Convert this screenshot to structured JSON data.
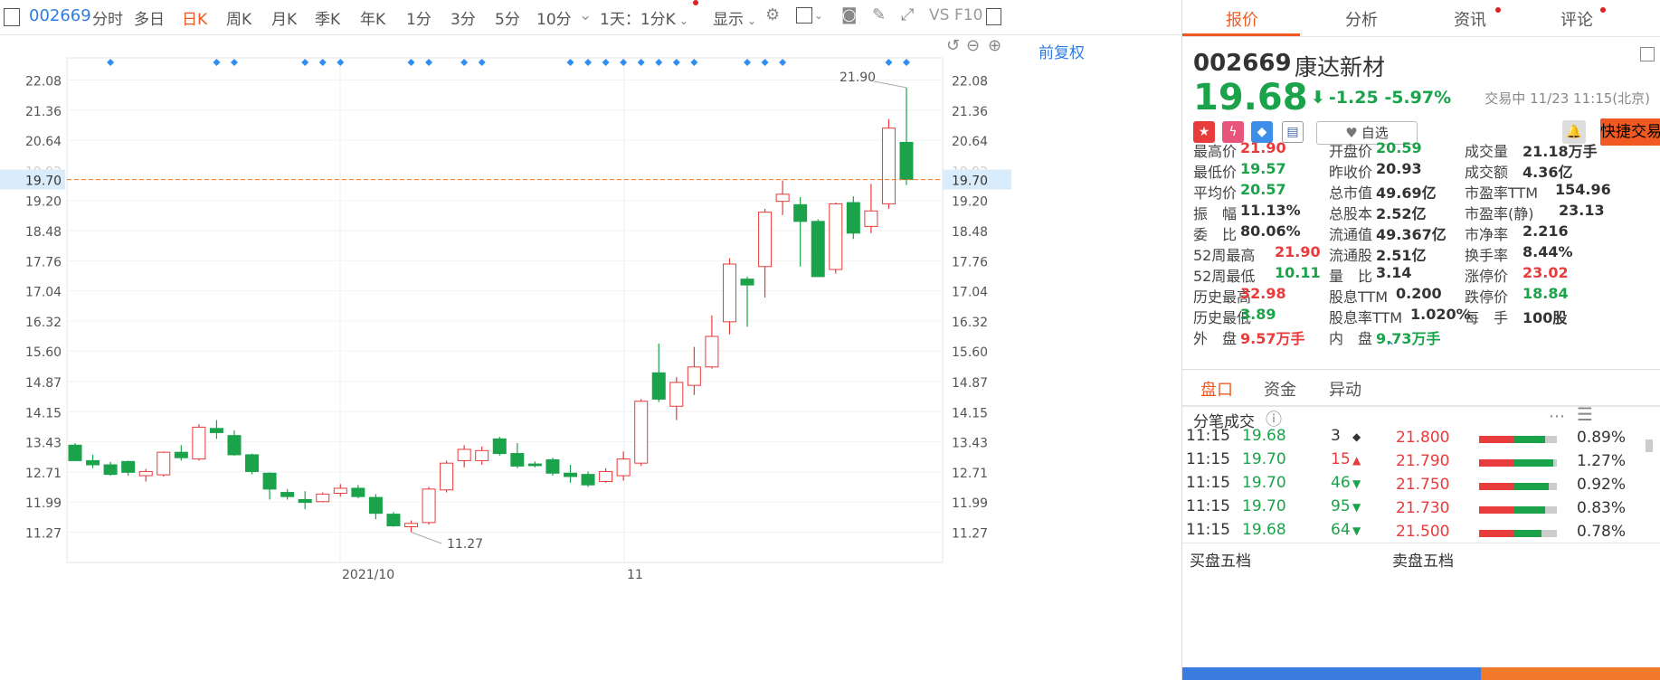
{
  "toolbar": {
    "code": "002669",
    "items": [
      "分时",
      "多日",
      "日K",
      "周K",
      "月K",
      "季K",
      "年K",
      "1分",
      "3分",
      "5分",
      "10分"
    ],
    "active": "日K",
    "period_select": "1天：1分K",
    "display": "显示",
    "vs": "VS",
    "f10": "F10"
  },
  "chart": {
    "restore_label": "前复权",
    "current_price_label": "19.70",
    "max_label": "21.90",
    "min_label": "11.27",
    "date_labels": [
      "2021/10",
      "11"
    ],
    "y_ticks": [
      "22.08",
      "21.36",
      "20.64",
      "19.92",
      "19.20",
      "18.48",
      "17.76",
      "17.04",
      "16.32",
      "15.60",
      "14.87",
      "14.15",
      "13.43",
      "12.71",
      "11.99",
      "11.27"
    ]
  },
  "chart_data": {
    "type": "candlestick",
    "ylim": [
      10.9,
      22.5
    ],
    "current_price": 19.7,
    "candles": [
      {
        "o": 13.35,
        "h": 13.4,
        "l": 12.98,
        "c": 12.98
      },
      {
        "o": 12.98,
        "h": 13.12,
        "l": 12.8,
        "c": 12.88
      },
      {
        "o": 12.88,
        "h": 12.95,
        "l": 12.62,
        "c": 12.65
      },
      {
        "o": 12.96,
        "h": 12.98,
        "l": 12.62,
        "c": 12.7
      },
      {
        "o": 12.62,
        "h": 12.78,
        "l": 12.48,
        "c": 12.72
      },
      {
        "o": 12.64,
        "h": 13.2,
        "l": 12.6,
        "c": 13.18
      },
      {
        "o": 13.18,
        "h": 13.35,
        "l": 12.98,
        "c": 13.05
      },
      {
        "o": 13.02,
        "h": 13.85,
        "l": 12.98,
        "c": 13.78
      },
      {
        "o": 13.75,
        "h": 13.95,
        "l": 13.5,
        "c": 13.65
      },
      {
        "o": 13.58,
        "h": 13.7,
        "l": 13.1,
        "c": 13.12
      },
      {
        "o": 13.12,
        "h": 13.15,
        "l": 12.65,
        "c": 12.72
      },
      {
        "o": 12.68,
        "h": 12.7,
        "l": 12.05,
        "c": 12.3
      },
      {
        "o": 12.22,
        "h": 12.3,
        "l": 12.05,
        "c": 12.12
      },
      {
        "o": 12.05,
        "h": 12.25,
        "l": 11.82,
        "c": 11.98
      },
      {
        "o": 12.0,
        "h": 12.22,
        "l": 11.98,
        "c": 12.18
      },
      {
        "o": 12.2,
        "h": 12.42,
        "l": 12.12,
        "c": 12.32
      },
      {
        "o": 12.32,
        "h": 12.4,
        "l": 12.08,
        "c": 12.12
      },
      {
        "o": 12.1,
        "h": 12.18,
        "l": 11.58,
        "c": 11.72
      },
      {
        "o": 11.7,
        "h": 11.75,
        "l": 11.4,
        "c": 11.42
      },
      {
        "o": 11.4,
        "h": 11.55,
        "l": 11.27,
        "c": 11.48
      },
      {
        "o": 11.5,
        "h": 12.35,
        "l": 11.45,
        "c": 12.3
      },
      {
        "o": 12.28,
        "h": 12.98,
        "l": 12.22,
        "c": 12.92
      },
      {
        "o": 12.98,
        "h": 13.35,
        "l": 12.82,
        "c": 13.25
      },
      {
        "o": 12.98,
        "h": 13.32,
        "l": 12.88,
        "c": 13.22
      },
      {
        "o": 13.5,
        "h": 13.55,
        "l": 13.1,
        "c": 13.15
      },
      {
        "o": 13.15,
        "h": 13.4,
        "l": 12.8,
        "c": 12.85
      },
      {
        "o": 12.9,
        "h": 12.96,
        "l": 12.82,
        "c": 12.86
      },
      {
        "o": 13.0,
        "h": 13.05,
        "l": 12.62,
        "c": 12.68
      },
      {
        "o": 12.68,
        "h": 12.88,
        "l": 12.45,
        "c": 12.6
      },
      {
        "o": 12.65,
        "h": 12.72,
        "l": 12.35,
        "c": 12.4
      },
      {
        "o": 12.48,
        "h": 12.8,
        "l": 12.45,
        "c": 12.72
      },
      {
        "o": 12.62,
        "h": 13.2,
        "l": 12.5,
        "c": 13.02
      },
      {
        "o": 12.92,
        "h": 14.45,
        "l": 12.85,
        "c": 14.4
      },
      {
        "o": 15.08,
        "h": 15.78,
        "l": 14.38,
        "c": 14.45
      },
      {
        "o": 14.28,
        "h": 14.98,
        "l": 13.95,
        "c": 14.85
      },
      {
        "o": 14.78,
        "h": 15.7,
        "l": 14.55,
        "c": 15.22
      },
      {
        "o": 15.22,
        "h": 16.45,
        "l": 15.18,
        "c": 15.95
      },
      {
        "o": 16.3,
        "h": 17.82,
        "l": 16.0,
        "c": 17.68
      },
      {
        "o": 17.32,
        "h": 17.38,
        "l": 16.18,
        "c": 17.18
      },
      {
        "o": 17.62,
        "h": 19.0,
        "l": 16.88,
        "c": 18.92
      },
      {
        "o": 19.18,
        "h": 19.68,
        "l": 18.85,
        "c": 19.35
      },
      {
        "o": 19.1,
        "h": 19.28,
        "l": 17.62,
        "c": 18.7
      },
      {
        "o": 18.7,
        "h": 18.75,
        "l": 17.38,
        "c": 17.38
      },
      {
        "o": 17.55,
        "h": 19.15,
        "l": 17.45,
        "c": 19.12
      },
      {
        "o": 19.15,
        "h": 19.3,
        "l": 18.28,
        "c": 18.42
      },
      {
        "o": 18.58,
        "h": 19.6,
        "l": 18.42,
        "c": 18.95
      },
      {
        "o": 19.12,
        "h": 21.15,
        "l": 19.0,
        "c": 20.93
      },
      {
        "o": 20.59,
        "h": 21.9,
        "l": 19.57,
        "c": 19.7
      }
    ],
    "markers_on_candles": [
      2,
      8,
      9,
      13,
      14,
      15,
      19,
      20,
      22,
      23,
      28,
      29,
      30,
      31,
      32,
      33,
      34,
      35,
      38,
      39,
      40,
      46,
      47
    ]
  },
  "quote": {
    "tabs": [
      "报价",
      "分析",
      "资讯",
      "评论"
    ],
    "code": "002669",
    "name": "康达新材",
    "price": "19.68",
    "arrow": "⬇",
    "change": "-1.25",
    "change_pct": "-5.97%",
    "trade_time": "交易中 11/23 11:15(北京)",
    "watch_label": "自选",
    "fast_trade": "快捷交易",
    "stats": [
      [
        [
          "最高价",
          "21.90",
          "up"
        ],
        [
          "开盘价",
          "20.59",
          "dn"
        ],
        [
          "成交量",
          "21.18万手",
          "nt"
        ]
      ],
      [
        [
          "最低价",
          "19.57",
          "dn"
        ],
        [
          "昨收价",
          "20.93",
          "nt"
        ],
        [
          "成交额",
          "4.36亿",
          "nt"
        ]
      ],
      [
        [
          "平均价",
          "20.57",
          "dn"
        ],
        [
          "总市值",
          "49.69亿",
          "nt"
        ],
        [
          "市盈率TTM",
          "154.96",
          "nt"
        ]
      ],
      [
        [
          "振　幅",
          "11.13%",
          "nt"
        ],
        [
          "总股本",
          "2.52亿",
          "nt"
        ],
        [
          "市盈率(静)",
          "23.13",
          "nt"
        ]
      ],
      [
        [
          "委　比",
          "80.06%",
          "nt"
        ],
        [
          "流通值",
          "49.367亿",
          "nt"
        ],
        [
          "市净率",
          "2.216",
          "nt"
        ]
      ],
      [
        [
          "52周最高",
          "21.90",
          "up"
        ],
        [
          "流通股",
          "2.51亿",
          "nt"
        ],
        [
          "换手率",
          "8.44%",
          "nt"
        ]
      ],
      [
        [
          "52周最低",
          "10.11",
          "dn"
        ],
        [
          "量　比",
          "3.14",
          "nt"
        ],
        [
          "涨停价",
          "23.02",
          "up"
        ]
      ],
      [
        [
          "历史最高",
          "32.98",
          "up"
        ],
        [
          "股息TTM",
          "0.200",
          "nt"
        ],
        [
          "跌停价",
          "18.84",
          "dn"
        ]
      ],
      [
        [
          "历史最低",
          "3.89",
          "dn"
        ],
        [
          "股息率TTM",
          "1.020%",
          "nt"
        ],
        [
          "每　手",
          "100股",
          "nt"
        ]
      ],
      [
        [
          "外　盘",
          "9.57万手",
          "up"
        ],
        [
          "内　盘",
          "9.73万手",
          "dn"
        ],
        [
          "",
          "",
          " nt"
        ]
      ]
    ],
    "sub_tabs": [
      "盘口",
      "资金",
      "异动"
    ],
    "ticks_title": "分笔成交",
    "ticks": [
      {
        "time": "11:15",
        "price": "19.68",
        "vol": "3",
        "dir": "◆",
        "pcls": "dn",
        "vcls": "nt"
      },
      {
        "time": "11:15",
        "price": "19.70",
        "vol": "15",
        "dir": "▲",
        "pcls": "dn",
        "vcls": "up"
      },
      {
        "time": "11:15",
        "price": "19.70",
        "vol": "46",
        "dir": "▼",
        "pcls": "dn",
        "vcls": "dn"
      },
      {
        "time": "11:15",
        "price": "19.70",
        "vol": "95",
        "dir": "▼",
        "pcls": "dn",
        "vcls": "dn"
      },
      {
        "time": "11:15",
        "price": "19.68",
        "vol": "64",
        "dir": "▼",
        "pcls": "dn",
        "vcls": "dn"
      }
    ],
    "levels": [
      {
        "price": "21.800",
        "pct": "0.89%",
        "red": 0.45,
        "green": 0.4
      },
      {
        "price": "21.790",
        "pct": "1.27%",
        "red": 0.45,
        "green": 0.5
      },
      {
        "price": "21.750",
        "pct": "0.92%",
        "red": 0.45,
        "green": 0.45
      },
      {
        "price": "21.730",
        "pct": "0.83%",
        "red": 0.45,
        "green": 0.4
      },
      {
        "price": "21.500",
        "pct": "0.78%",
        "red": 0.45,
        "green": 0.35
      }
    ],
    "buy5": "买盘五档",
    "sell5": "卖盘五档"
  },
  "colors": {
    "up": "#e83b3b",
    "down": "#1aa34a",
    "accent": "#f05a22",
    "link": "#2f7ce0"
  }
}
